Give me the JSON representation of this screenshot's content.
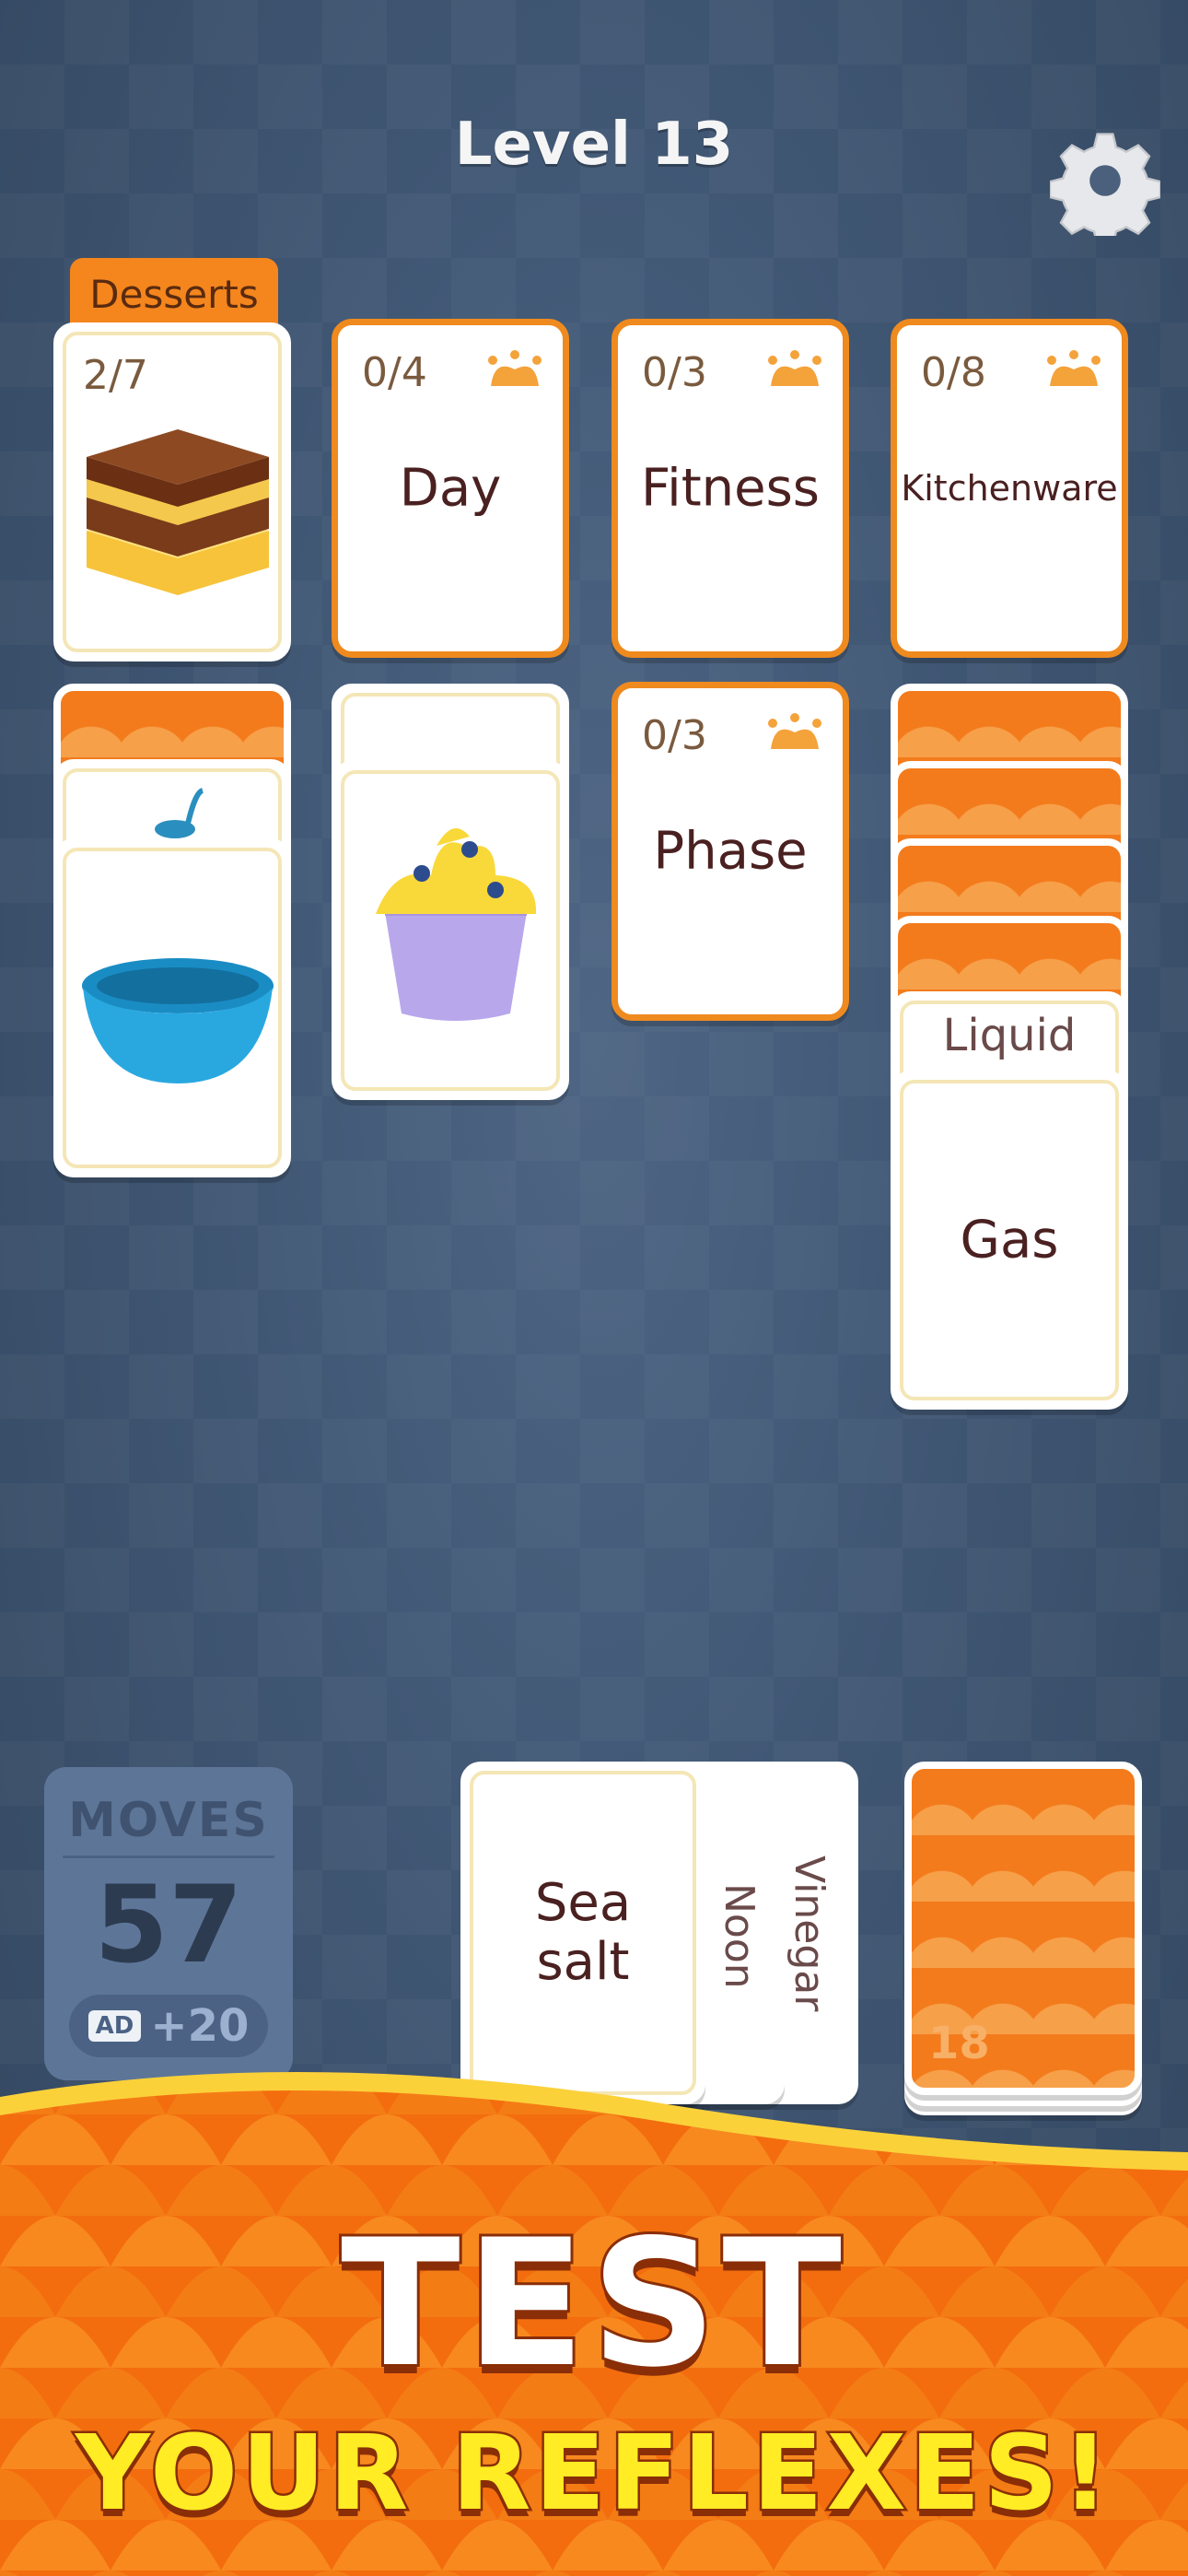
{
  "header": {
    "level": "Level 13"
  },
  "category_tab": "Desserts",
  "foundations": [
    {
      "count": "2/7",
      "word": ""
    },
    {
      "count": "0/4",
      "word": "Day"
    },
    {
      "count": "0/3",
      "word": "Fitness"
    },
    {
      "count": "0/8",
      "word": "Kitchenware"
    }
  ],
  "tableau": {
    "phase": {
      "count": "0/3",
      "word": "Phase"
    },
    "liquid": "Liquid",
    "gas": "Gas"
  },
  "moves": {
    "label": "MOVES",
    "value": "57",
    "ad_badge": "AD",
    "ad_bonus": "+20"
  },
  "hand": {
    "top": "Sea salt",
    "second": "Noon",
    "third": "Vinegar"
  },
  "deck": {
    "count": "18"
  },
  "banner": {
    "line1": "TEST",
    "line2": "YOUR REFLEXES!"
  },
  "colors": {
    "accent": "#f4861d",
    "card_border": "#ef8a1f",
    "background": "#3f5673",
    "banner_yellow": "#ffec24"
  }
}
